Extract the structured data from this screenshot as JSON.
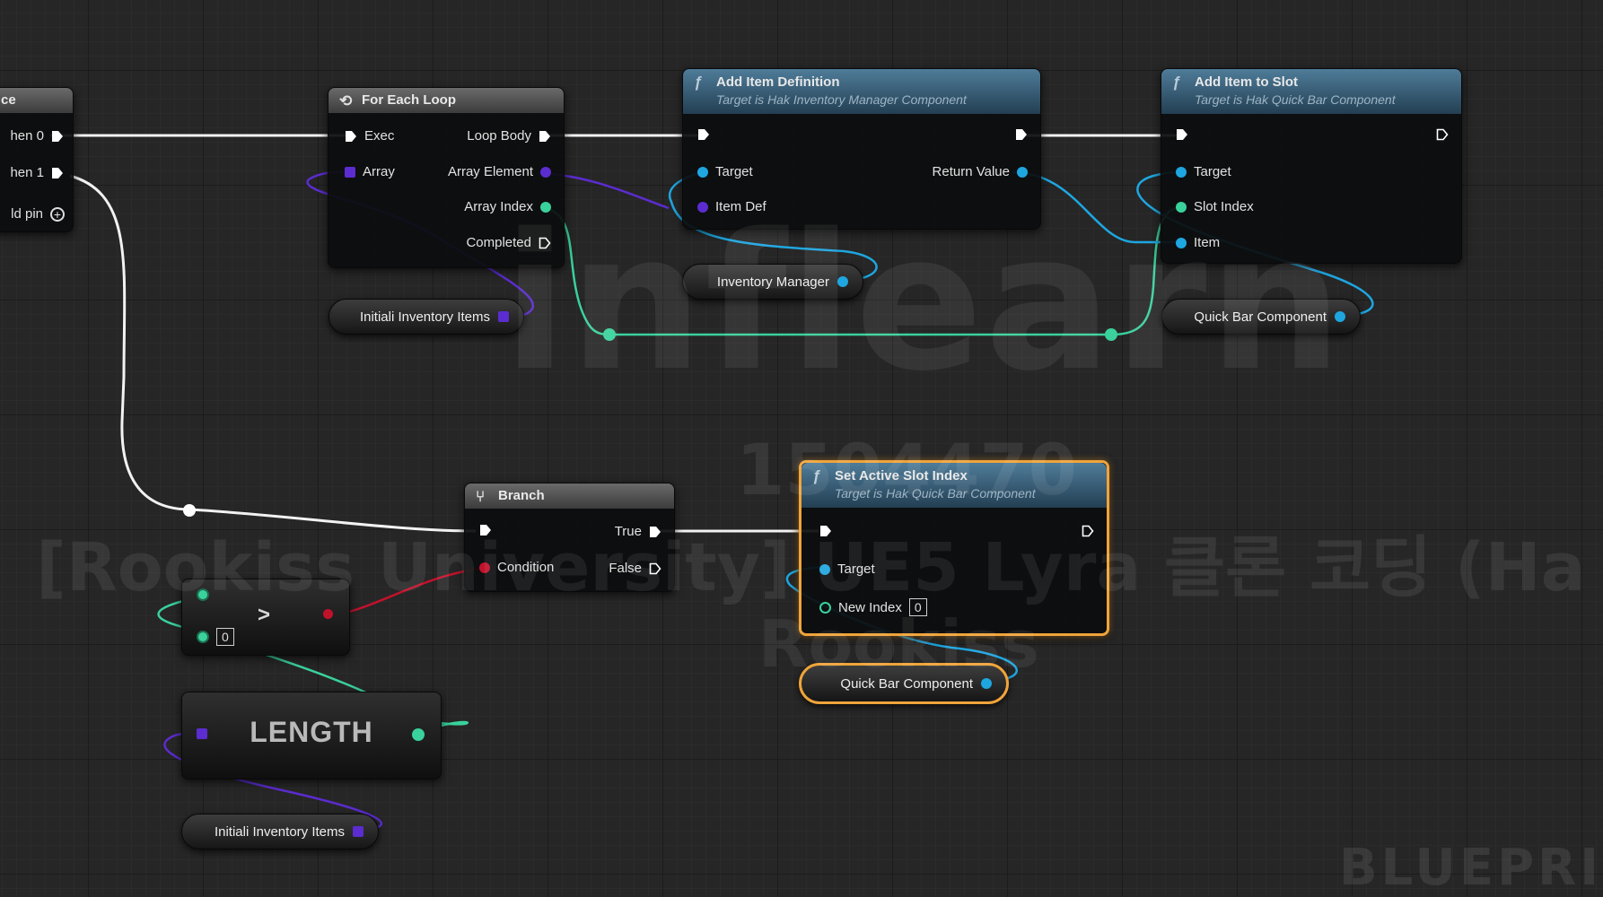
{
  "nodes": {
    "sequence": {
      "title_fragment": "ce",
      "pins": [
        "hen 0",
        "hen 1",
        "ld pin"
      ]
    },
    "for_each_loop": {
      "title": "For Each Loop",
      "exec_label": "Exec",
      "array_label": "Array",
      "loop_body_label": "Loop Body",
      "array_element_label": "Array Element",
      "array_index_label": "Array Index",
      "completed_label": "Completed"
    },
    "add_item_definition": {
      "title": "Add Item Definition",
      "subtitle": "Target is Hak Inventory Manager Component",
      "target_label": "Target",
      "item_def_label": "Item Def",
      "return_value_label": "Return Value"
    },
    "add_item_to_slot": {
      "title": "Add Item to Slot",
      "subtitle": "Target is Hak Quick Bar Component",
      "target_label": "Target",
      "slot_index_label": "Slot Index",
      "item_label": "Item"
    },
    "branch": {
      "title": "Branch",
      "condition_label": "Condition",
      "true_label": "True",
      "false_label": "False"
    },
    "set_active_slot_index": {
      "title": "Set Active Slot Index",
      "subtitle": "Target is Hak Quick Bar Component",
      "target_label": "Target",
      "new_index_label": "New Index",
      "new_index_value": "0"
    },
    "greater": {
      "operator": ">",
      "b_value": "0"
    },
    "length": {
      "label": "LENGTH"
    }
  },
  "variables": {
    "initial_inventory_items_top": "Initiali Inventory Items",
    "inventory_manager": "Inventory Manager",
    "quick_bar_component_top": "Quick Bar Component",
    "quick_bar_component_bottom": "Quick Bar Component",
    "initial_inventory_items_bottom": "Initiali Inventory Items"
  },
  "watermarks": {
    "logo": "inflearn",
    "id": "1504470",
    "course": "[Rookiss University] UE5 Lyra 클론 코딩 (Ha",
    "author": "Rookiss",
    "corner": "BLUEPRI"
  },
  "colors": {
    "exec_wire": "#ffffff",
    "object_pin": "#1ea6e0",
    "integer_pin": "#3ad19c",
    "array_pin": "#5b2ccf",
    "boolean_pin": "#c1122c",
    "selection": "#f0a43a",
    "function_header": "#3f6a86",
    "macro_header": "#5a5a5a"
  }
}
